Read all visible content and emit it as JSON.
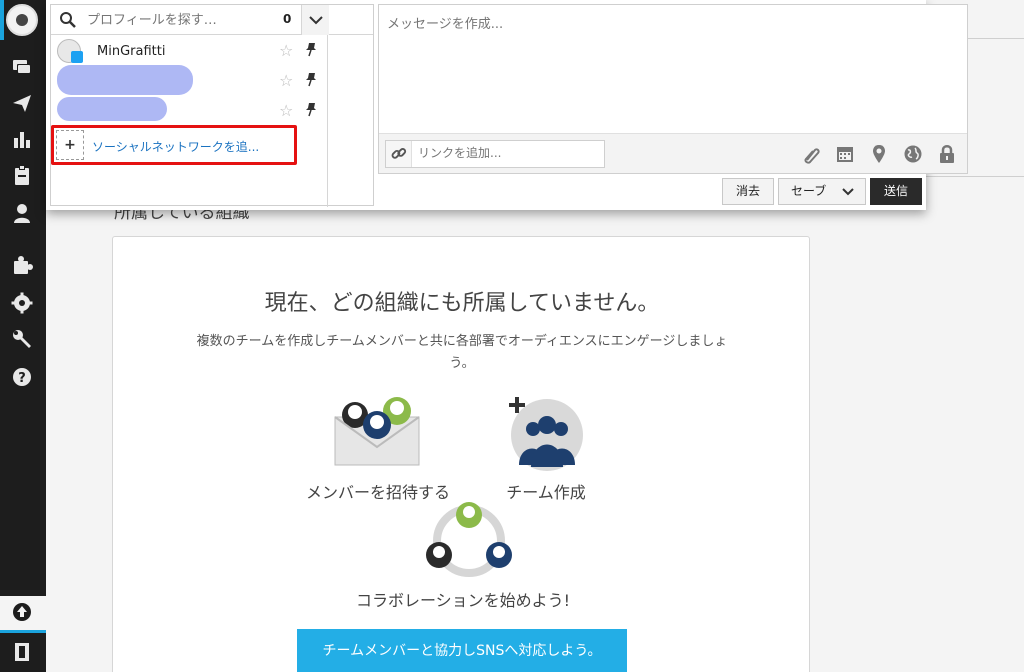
{
  "sidebar": {
    "nav": [
      "streams-icon",
      "publisher-icon",
      "analytics-icon",
      "assignments-icon",
      "contacts-icon",
      "apps-icon",
      "settings-icon",
      "tools-icon",
      "help-icon"
    ],
    "bottom": [
      "upgrade-icon",
      "logout-icon"
    ]
  },
  "composer": {
    "search_placeholder": "プロフィールを探す…",
    "selected_count": "0",
    "profiles": [
      {
        "name": "MinGrafitti",
        "network": "twitter"
      }
    ],
    "add_network_label": "ソーシャルネットワークを追...",
    "message_placeholder": "メッセージを作成...",
    "link_placeholder": "リンクを追加...",
    "toolbar_icons": [
      "paperclip-icon",
      "calendar-icon",
      "location-icon",
      "globe-icon",
      "lock-icon"
    ],
    "buttons": {
      "clear": "消去",
      "save": "セーブ",
      "send": "送信"
    }
  },
  "page": {
    "section_heading": "所属している組織",
    "empty_title": "現在、どの組織にも所属していません。",
    "empty_description": "複数のチームを作成しチームメンバーと共に各部署でオーディエンスにエンゲージしましょう。",
    "features": {
      "invite": "メンバーを招待する",
      "create_team": "チーム作成",
      "collaborate": "コラボレーションを始めよう!"
    },
    "cta": "チームメンバーと協力しSNSへ対応しよう。"
  },
  "colors": {
    "sidebar_bg": "#1d1d1d",
    "accent_blue": "#23aee6",
    "highlight_red": "#e51111",
    "send_button": "#2a2a2a"
  }
}
